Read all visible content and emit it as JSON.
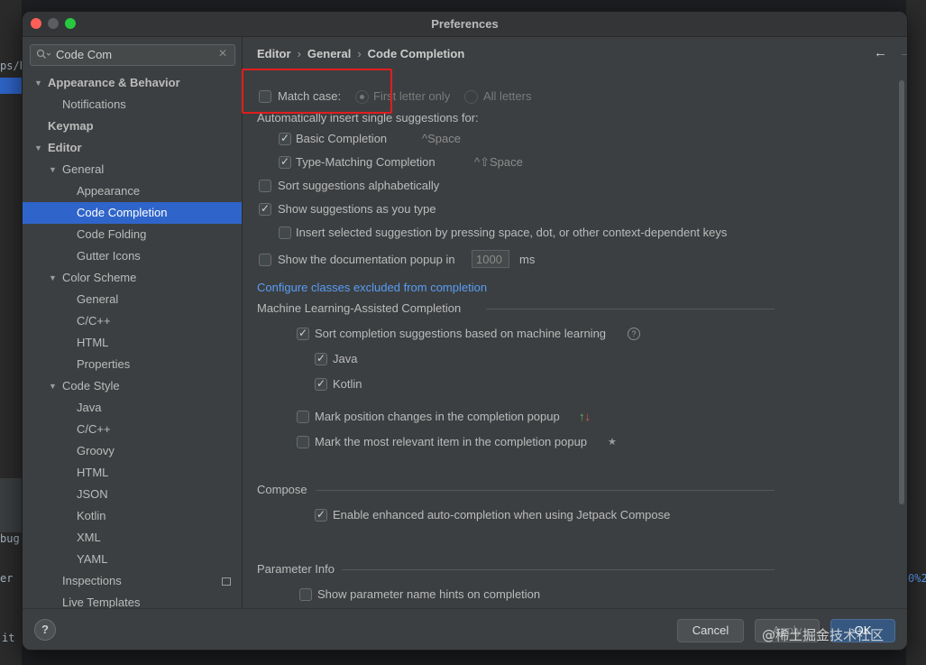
{
  "window": {
    "title": "Preferences"
  },
  "search": {
    "value": "Code Com"
  },
  "tree": [
    {
      "label": "Appearance & Behavior",
      "level": 0,
      "arrow": "down",
      "bold": true
    },
    {
      "label": "Notifications",
      "level": 2
    },
    {
      "label": "Keymap",
      "level": 0,
      "bold": true
    },
    {
      "label": "Editor",
      "level": 0,
      "arrow": "down",
      "bold": true
    },
    {
      "label": "General",
      "level": 1,
      "arrow": "down"
    },
    {
      "label": "Appearance",
      "level": 3
    },
    {
      "label": "Code Completion",
      "level": 3,
      "selected": true
    },
    {
      "label": "Code Folding",
      "level": 3
    },
    {
      "label": "Gutter Icons",
      "level": 3
    },
    {
      "label": "Color Scheme",
      "level": 1,
      "arrow": "down"
    },
    {
      "label": "General",
      "level": 3
    },
    {
      "label": "C/C++",
      "level": 3
    },
    {
      "label": "HTML",
      "level": 3
    },
    {
      "label": "Properties",
      "level": 3
    },
    {
      "label": "Code Style",
      "level": 1,
      "arrow": "down"
    },
    {
      "label": "Java",
      "level": 3
    },
    {
      "label": "C/C++",
      "level": 3
    },
    {
      "label": "Groovy",
      "level": 3
    },
    {
      "label": "HTML",
      "level": 3
    },
    {
      "label": "JSON",
      "level": 3
    },
    {
      "label": "Kotlin",
      "level": 3
    },
    {
      "label": "XML",
      "level": 3
    },
    {
      "label": "YAML",
      "level": 3
    },
    {
      "label": "Inspections",
      "level": 2,
      "pageIcon": true
    },
    {
      "label": "Live Templates",
      "level": 2
    }
  ],
  "breadcrumb": {
    "part1": "Editor",
    "part2": "General",
    "part3": "Code Completion",
    "separator": "›"
  },
  "nav": {
    "back": "←",
    "forward": "→"
  },
  "settings": {
    "match_case": {
      "label": "Match case:",
      "checked": false
    },
    "first_letter": {
      "label": "First letter only",
      "selected": true
    },
    "all_letters": {
      "label": "All letters",
      "selected": false
    },
    "auto_insert": "Automatically insert single suggestions for:",
    "basic": {
      "label": "Basic Completion",
      "shortcut": "^Space",
      "checked": true
    },
    "type_matching": {
      "label": "Type-Matching Completion",
      "shortcut": "^⇧Space",
      "checked": true
    },
    "sort_alpha": {
      "label": "Sort suggestions alphabetically",
      "checked": false
    },
    "show_as_type": {
      "label": "Show suggestions as you type",
      "checked": true
    },
    "insert_selected": {
      "label": "Insert selected suggestion by pressing space, dot, or other context-dependent keys",
      "checked": false
    },
    "doc_popup": {
      "label": "Show the documentation popup in",
      "value": "1000",
      "unit": "ms",
      "checked": false
    },
    "configure_link": "Configure classes excluded from completion",
    "ml_section": "Machine Learning-Assisted Completion",
    "ml_sort": {
      "label": "Sort completion suggestions based on machine learning",
      "checked": true
    },
    "java": {
      "label": "Java",
      "checked": true
    },
    "kotlin": {
      "label": "Kotlin",
      "checked": true
    },
    "mark_position": {
      "label": "Mark position changes in the completion popup",
      "checked": false
    },
    "mark_relevant": {
      "label": "Mark the most relevant item in the completion popup",
      "checked": false
    },
    "compose_section": "Compose",
    "compose_enhanced": {
      "label": "Enable enhanced auto-completion when using Jetpack Compose",
      "checked": true
    },
    "param_section": "Parameter Info",
    "param_hints": {
      "label": "Show parameter name hints on completion",
      "checked": false
    }
  },
  "footer": {
    "help": "?",
    "cancel": "Cancel",
    "apply": "Apply",
    "ok": "OK"
  },
  "watermark": "@稀土掘金技术社区",
  "background": {
    "frag1": "ps/h",
    "frag2": "bug",
    "frag3": "er",
    "frag4": "it",
    "frag5": "0%2"
  },
  "colors": {
    "selection": "#2f65ca",
    "link": "#589df6",
    "highlight": "#e11d1d",
    "ok": "#365880"
  }
}
